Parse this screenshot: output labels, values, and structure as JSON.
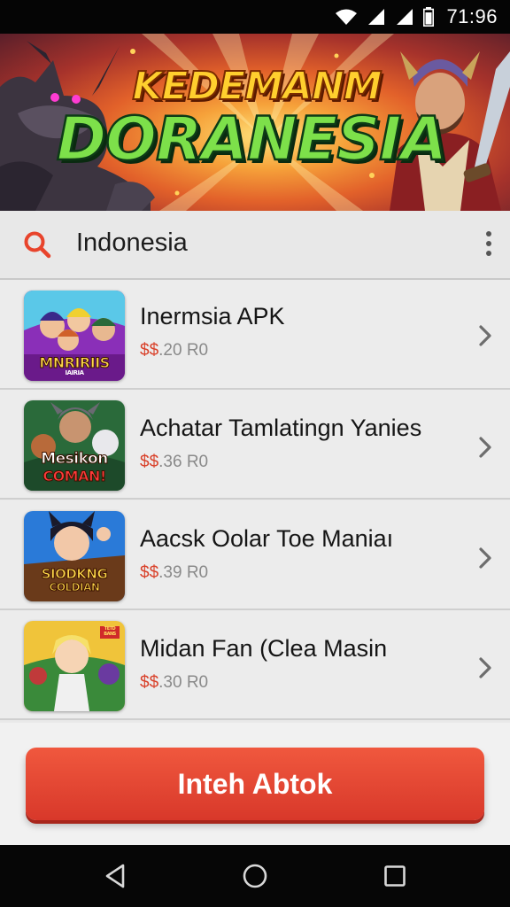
{
  "status_bar": {
    "time": "71:96"
  },
  "banner": {
    "title_line1": "KEDEMANM",
    "title_line2": "DORANESIA"
  },
  "search": {
    "value": "Indonesia"
  },
  "list": {
    "items": [
      {
        "title": "Inermsia  APK",
        "price_currency": "$$",
        "price_value": ".20 R0",
        "thumb_caption_1": "MNRIRIIS",
        "thumb_caption_2": "IAIRIA"
      },
      {
        "title": "Achatar Tamlatingn Yanies",
        "price_currency": "$$",
        "price_value": ".36 R0",
        "thumb_caption_1": "Mesikon",
        "thumb_caption_2": "COMAN!"
      },
      {
        "title": "Aacsk Oolar Toe Maniaı",
        "price_currency": "$$",
        "price_value": ".39 R0",
        "thumb_caption_1": "SIODKNG",
        "thumb_caption_2": "COLDIAN"
      },
      {
        "title": "Midan Fan (Clea Masin",
        "price_currency": "$$",
        "price_value": ".30 R0",
        "thumb_caption_1": "TETD",
        "thumb_caption_2": "BANS"
      }
    ]
  },
  "cta": {
    "label": "Inteh Abtok"
  },
  "colors": {
    "accent": "#e4452f",
    "price_currency": "#d9412a",
    "search_icon": "#e8442c"
  }
}
